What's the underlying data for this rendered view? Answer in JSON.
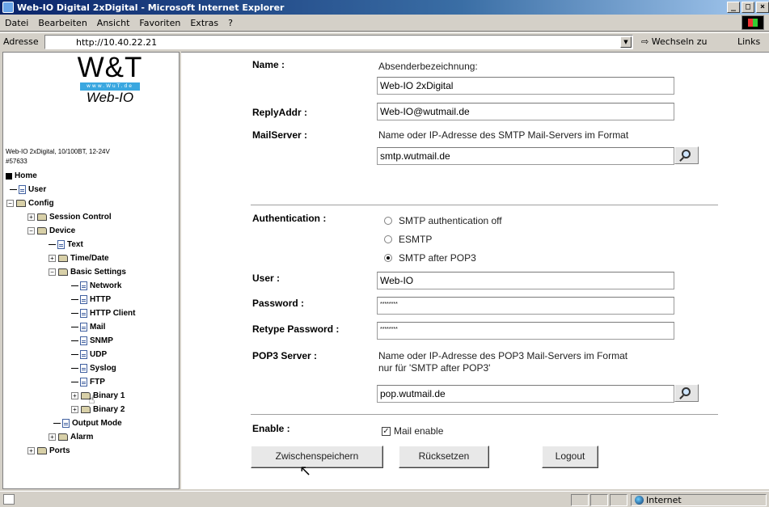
{
  "window": {
    "title": "Web-IO Digital 2xDigital - Microsoft Internet Explorer",
    "controls": [
      "_",
      "□",
      "×"
    ]
  },
  "menu": [
    "Datei",
    "Bearbeiten",
    "Ansicht",
    "Favoriten",
    "Extras",
    "?"
  ],
  "address": {
    "label": "Adresse",
    "url": "http://10.40.22.21",
    "go_label": "Wechseln zu",
    "links_label": "Links"
  },
  "sidebar": {
    "logo": {
      "main": "W&T",
      "url": "www.WuT.de",
      "sub": "Web-IO"
    },
    "device_info": "Web-IO 2xDigital, 10/100BT, 12-24V",
    "device_number": "#57633",
    "tree": [
      {
        "label": "Home"
      },
      {
        "label": "User"
      },
      {
        "label": "Config"
      },
      {
        "label": "Session Control"
      },
      {
        "label": "Device"
      },
      {
        "label": "Text"
      },
      {
        "label": "Time/Date"
      },
      {
        "label": "Basic Settings"
      },
      {
        "label": "Network"
      },
      {
        "label": "HTTP"
      },
      {
        "label": "HTTP Client"
      },
      {
        "label": "Mail"
      },
      {
        "label": "SNMP"
      },
      {
        "label": "UDP"
      },
      {
        "label": "Syslog"
      },
      {
        "label": "FTP"
      },
      {
        "label": "Binary 1"
      },
      {
        "label": "Binary 2"
      },
      {
        "label": "Output Mode"
      },
      {
        "label": "Alarm"
      },
      {
        "label": "Ports"
      }
    ]
  },
  "form": {
    "name_label": "Name :",
    "name_hint": "Absenderbezeichnung:",
    "name_value": "Web-IO 2xDigital",
    "reply_label": "ReplyAddr :",
    "reply_value": "Web-IO@wutmail.de",
    "mailserver_label": "MailServer :",
    "mailserver_hint": "Name oder IP-Adresse des SMTP Mail-Servers im Format",
    "mailserver_value": "smtp.wutmail.de",
    "auth_label": "Authentication :",
    "auth_options": [
      "SMTP authentication off",
      "ESMTP",
      "SMTP after POP3"
    ],
    "auth_selected": "SMTP after POP3",
    "user_label": "User :",
    "user_value": "Web-IO",
    "password_label": "Password :",
    "password_value": "********",
    "retype_label": "Retype Password :",
    "retype_value": "********",
    "pop3_label": "POP3 Server :",
    "pop3_hint_1": "Name oder IP-Adresse des POP3 Mail-Servers im Format",
    "pop3_hint_2": "nur für 'SMTP after POP3'",
    "pop3_value": "pop.wutmail.de",
    "enable_label": "Enable :",
    "enable_option": "Mail enable",
    "enable_checked": true,
    "save_button": "Zwischenspeichern",
    "reset_button": "Rücksetzen",
    "logout_button": "Logout"
  },
  "status": {
    "zone": "Internet"
  }
}
